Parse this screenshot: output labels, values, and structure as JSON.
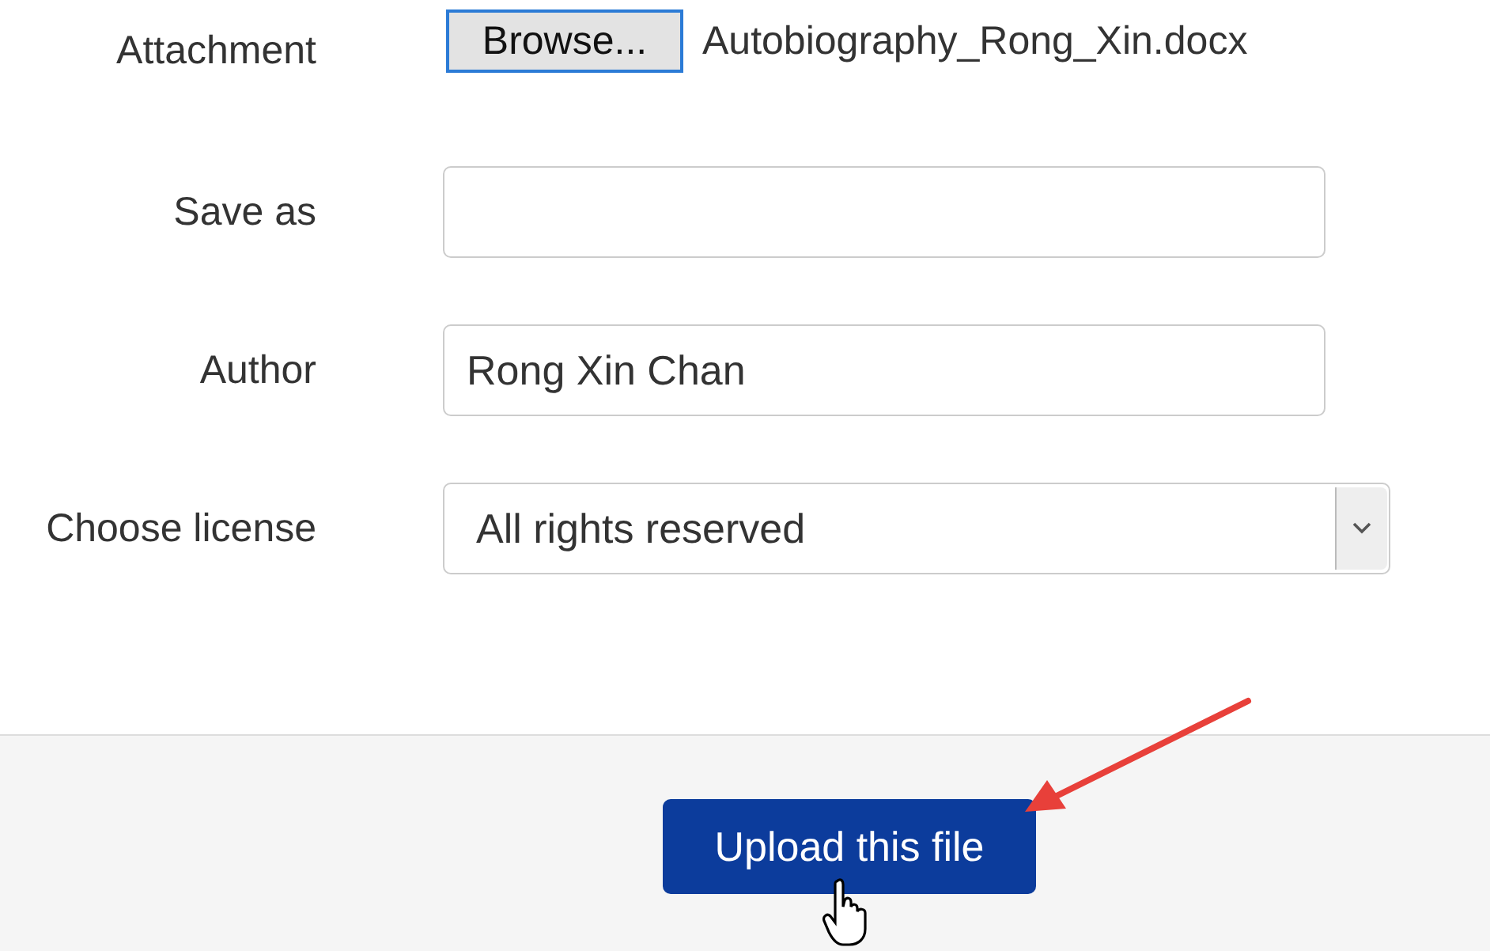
{
  "form": {
    "fields": [
      {
        "kind": "file",
        "label": "Attachment",
        "button": "Browse...",
        "value": "Autobiography_Rong_Xin.docx"
      },
      {
        "kind": "text",
        "label": "Save as"
      },
      {
        "kind": "text",
        "label": "Author",
        "value": "Rong Xin Chan"
      },
      {
        "kind": "select",
        "label": "Choose license",
        "value": "All rights reserved"
      }
    ]
  },
  "footer": {
    "button": "Upload this file"
  }
}
